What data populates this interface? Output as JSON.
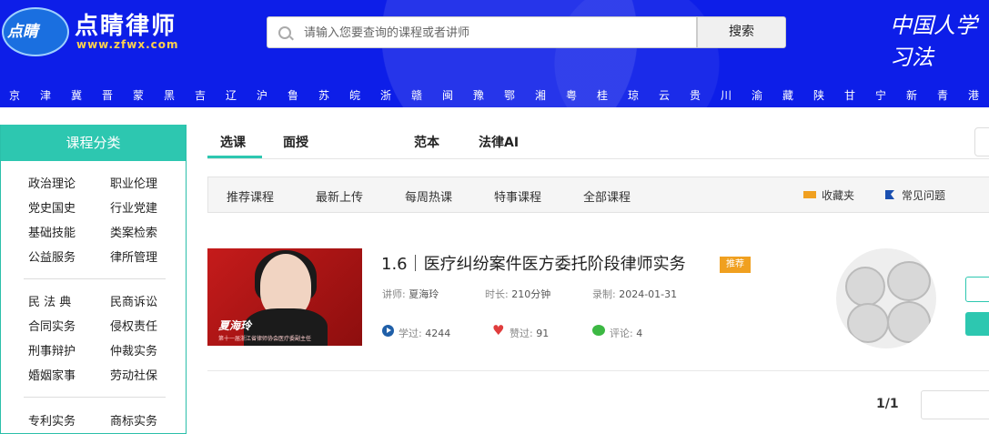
{
  "header": {
    "logo_text": "点睛",
    "brand_title": "点睛律师",
    "brand_url": "www.zfwx.com",
    "search_placeholder": "请输入您要查询的课程或者讲师",
    "search_button": "搜索",
    "right_logo": "中国人学习法",
    "colors": {
      "background": "#0d1ee8",
      "accent": "#2dc7b0"
    }
  },
  "regions": [
    "京",
    "津",
    "冀",
    "晋",
    "蒙",
    "黑",
    "吉",
    "辽",
    "沪",
    "鲁",
    "苏",
    "皖",
    "浙",
    "赣",
    "闽",
    "豫",
    "鄂",
    "湘",
    "粤",
    "桂",
    "琼",
    "云",
    "贵",
    "川",
    "渝",
    "藏",
    "陕",
    "甘",
    "宁",
    "新",
    "青",
    "港"
  ],
  "sidebar": {
    "title": "课程分类",
    "groups": [
      [
        "政治理论",
        "职业伦理",
        "党史国史",
        "行业党建",
        "基础技能",
        "类案检索",
        "公益服务",
        "律所管理"
      ],
      [
        "民 法 典",
        "民商诉讼",
        "合同实务",
        "侵权责任",
        "刑事辩护",
        "仲裁实务",
        "婚姻家事",
        "劳动社保"
      ],
      [
        "专利实务",
        "商标实务"
      ]
    ]
  },
  "tabs": [
    "选课",
    "面授",
    "范本",
    "法律AI"
  ],
  "subnav": {
    "items": [
      "推荐课程",
      "最新上传",
      "每周热课",
      "特事课程",
      "全部课程"
    ],
    "bookmark": "收藏夹",
    "faq": "常见问题"
  },
  "course": {
    "title": "1.6｜医疗纠纷案件医方委托阶段律师实务",
    "tag": "推荐",
    "lecturer_label": "讲师:",
    "lecturer": "夏海玲",
    "duration_label": "时长:",
    "duration": "210分钟",
    "recorded_label": "录制:",
    "recorded": "2024-01-31",
    "learned_label": "学过:",
    "learned": "4244",
    "likes_label": "赞过:",
    "likes": "91",
    "comments_label": "评论:",
    "comments": "4",
    "thumb_name": "夏海玲",
    "thumb_sub": "第十一届浙江省律师协会医疗委副主任"
  },
  "pager": {
    "text": "1/1"
  }
}
